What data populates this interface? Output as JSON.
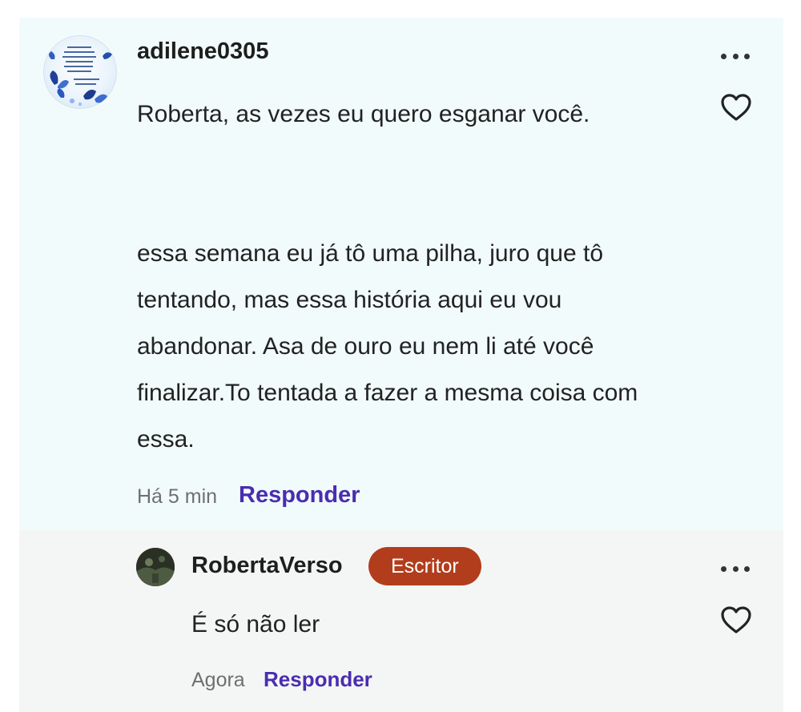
{
  "comment": {
    "username": "adilene0305",
    "text": "Roberta, as vezes eu quero esganar você.\n\n\nessa semana eu já tô uma pilha, juro que tô tentando, mas essa história aqui eu vou abandonar.  Asa de ouro  eu nem li até você finalizar.To tentada a fazer a mesma coisa com essa.",
    "time": "Há 5 min",
    "reply_label": "Responder"
  },
  "reply": {
    "username": "RobertaVerso",
    "badge": "Escritor",
    "text": "É só não ler",
    "time": "Agora",
    "reply_label": "Responder"
  },
  "colors": {
    "comment_bg": "#f1fbfb",
    "reply_bg": "#f4f6f5",
    "accent": "#4a2db0",
    "badge_bg": "#b23d1c"
  },
  "icons": [
    "more-options-icon",
    "heart-icon"
  ]
}
